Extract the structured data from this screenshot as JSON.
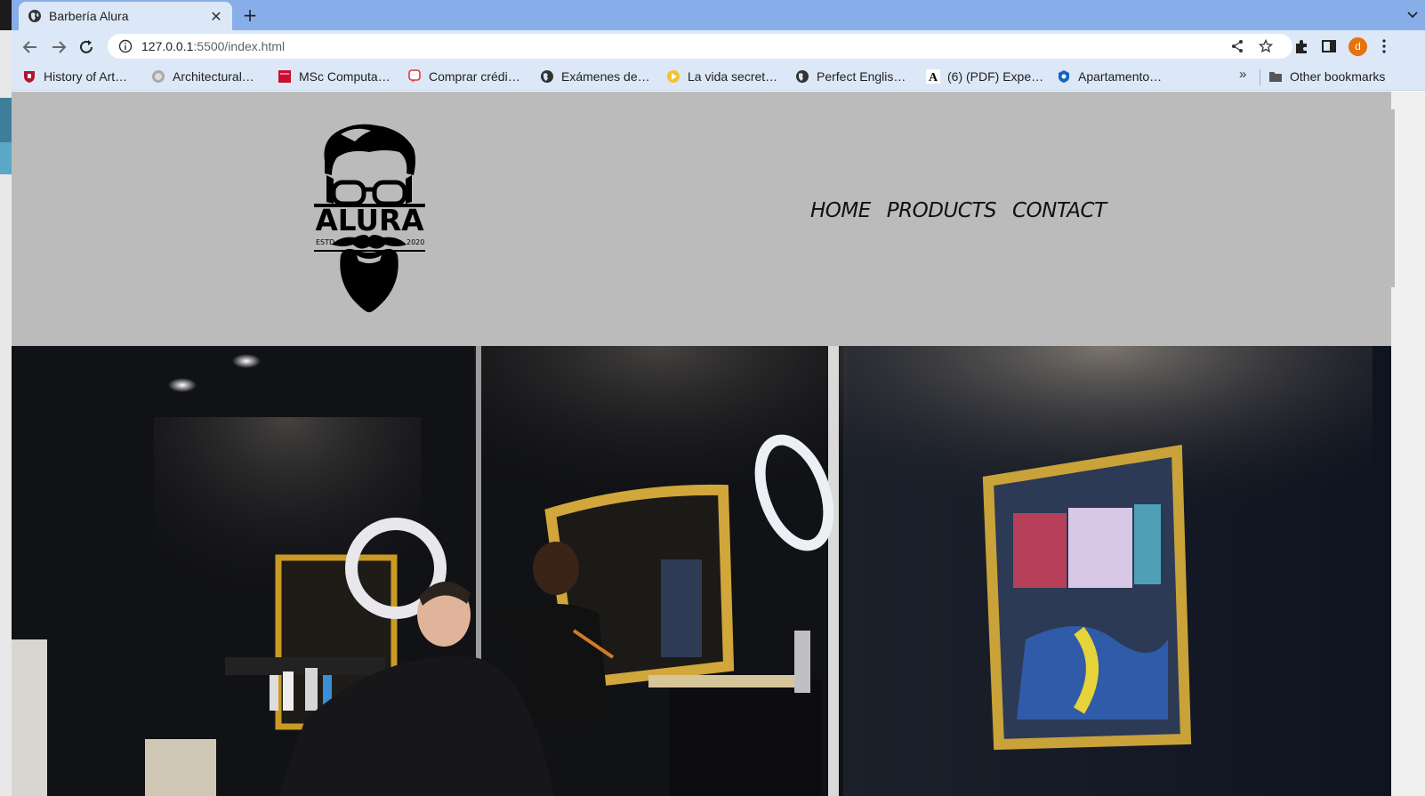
{
  "browser": {
    "tab": {
      "title": "Barbería Alura",
      "favicon": "globe-icon"
    },
    "new_tab_label": "+",
    "close_label": "✕",
    "url": {
      "host": "127.0.0.1",
      "rest": ":5500/index.html"
    },
    "profile_initial": "d",
    "bookmarks": [
      {
        "label": "History of Art…",
        "icon": "shield-icon"
      },
      {
        "label": "Architectural…",
        "icon": "gear-badge-icon"
      },
      {
        "label": "MSc Computa…",
        "icon": "book-icon"
      },
      {
        "label": "Comprar crédi…",
        "icon": "chat-icon"
      },
      {
        "label": "Exámenes de…",
        "icon": "globe-icon"
      },
      {
        "label": "La vida secret…",
        "icon": "play-icon"
      },
      {
        "label": "Perfect Englis…",
        "icon": "globe-icon"
      },
      {
        "label": "(6) (PDF) Expe…",
        "icon": "letter-a-icon"
      },
      {
        "label": "Apartamento…",
        "icon": "pin-icon"
      }
    ],
    "more_bookmarks_label": "»",
    "other_bookmarks_label": "Other bookmarks"
  },
  "site": {
    "logo": {
      "wordmark": "ALURA",
      "left_caption": "ESTD",
      "right_caption": "2020"
    },
    "nav": [
      {
        "label": "HOME"
      },
      {
        "label": "PRODUCTS"
      },
      {
        "label": "CONTACT"
      }
    ]
  },
  "colors": {
    "tabstrip": "#87aee8",
    "toolbar": "#dce7f7",
    "header_bg": "#bbbbbb",
    "profile": "#e8710a"
  }
}
